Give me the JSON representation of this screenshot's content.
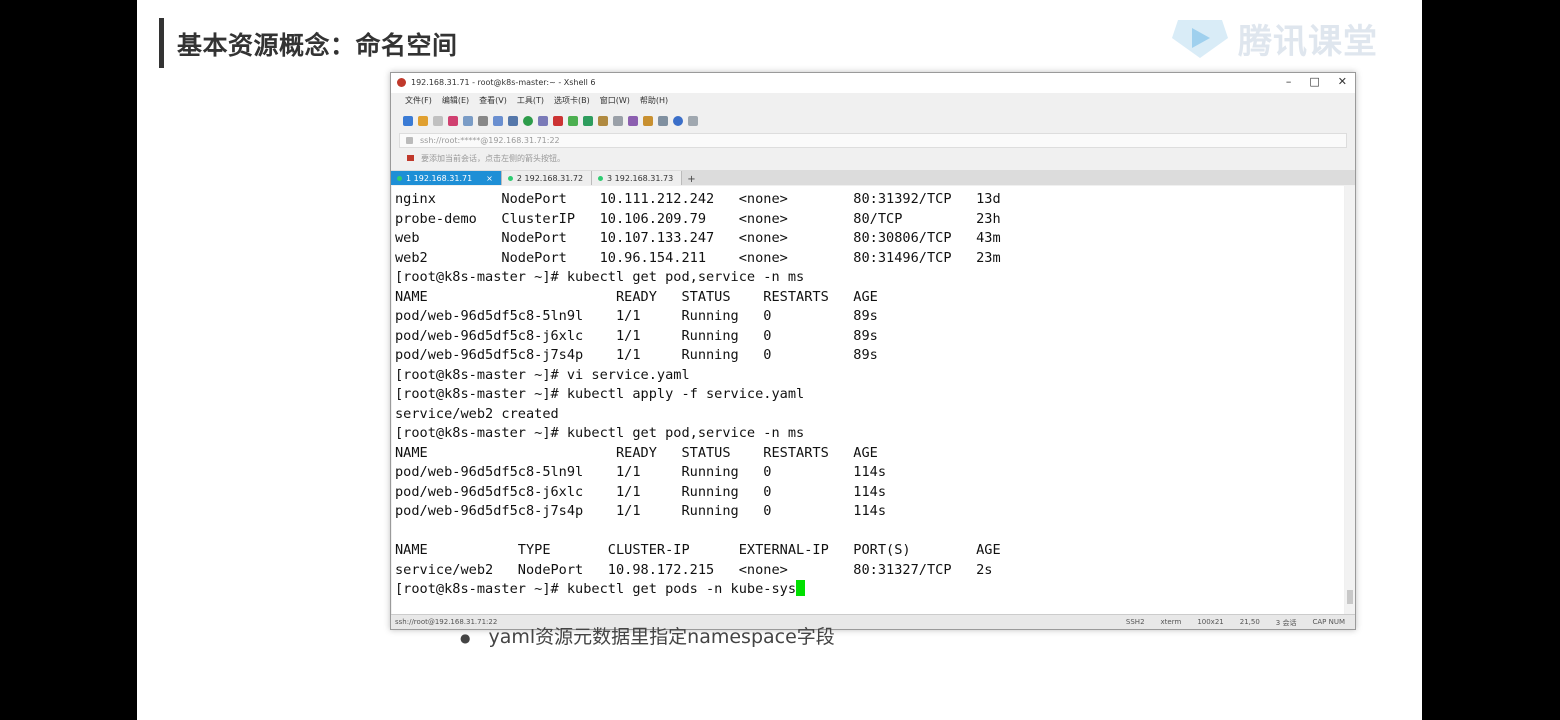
{
  "slide": {
    "title": "基本资源概念：命名空间",
    "logo_text": "腾讯课堂",
    "bullet": "yaml资源元数据里指定namespace字段"
  },
  "window": {
    "title": "192.168.31.71 - root@k8s-master:~ - Xshell 6",
    "controls": [
      "–",
      "□",
      "✕"
    ],
    "menu": [
      "文件(F)",
      "编辑(E)",
      "查看(V)",
      "工具(T)",
      "选项卡(B)",
      "窗口(W)",
      "帮助(H)"
    ],
    "address": "ssh://root:*****@192.168.31.71:22",
    "notice": "要添加当前会话，点击左侧的箭头按钮。",
    "tabs": [
      {
        "label": "1 192.168.31.71",
        "active": true
      },
      {
        "label": "2 192.168.31.72",
        "active": false
      },
      {
        "label": "3 192.168.31.73",
        "active": false
      }
    ],
    "tab_plus": "+",
    "status_left": "ssh://root@192.168.31.71:22",
    "status_right": [
      "SSH2",
      "xterm",
      "100x21",
      "21,50",
      "3 会话",
      "CAP NUM"
    ]
  },
  "terminal": {
    "lines": [
      "nginx        NodePort    10.111.212.242   <none>        80:31392/TCP   13d",
      "probe-demo   ClusterIP   10.106.209.79    <none>        80/TCP         23h",
      "web          NodePort    10.107.133.247   <none>        80:30806/TCP   43m",
      "web2         NodePort    10.96.154.211    <none>        80:31496/TCP   23m",
      "[root@k8s-master ~]# kubectl get pod,service -n ms",
      "NAME                       READY   STATUS    RESTARTS   AGE",
      "pod/web-96d5df5c8-5ln9l    1/1     Running   0          89s",
      "pod/web-96d5df5c8-j6xlc    1/1     Running   0          89s",
      "pod/web-96d5df5c8-j7s4p    1/1     Running   0          89s",
      "[root@k8s-master ~]# vi service.yaml",
      "[root@k8s-master ~]# kubectl apply -f service.yaml",
      "service/web2 created",
      "[root@k8s-master ~]# kubectl get pod,service -n ms",
      "NAME                       READY   STATUS    RESTARTS   AGE",
      "pod/web-96d5df5c8-5ln9l    1/1     Running   0          114s",
      "pod/web-96d5df5c8-j6xlc    1/1     Running   0          114s",
      "pod/web-96d5df5c8-j7s4p    1/1     Running   0          114s",
      "",
      "NAME           TYPE       CLUSTER-IP      EXTERNAL-IP   PORT(S)        AGE",
      "service/web2   NodePort   10.98.172.215   <none>        80:31327/TCP   2s"
    ],
    "prompt_line": "[root@k8s-master ~]# kubectl get pods -n kube-sys"
  },
  "colors": {
    "tab_active": "#1e8fd6",
    "cursor": "#00e000"
  }
}
